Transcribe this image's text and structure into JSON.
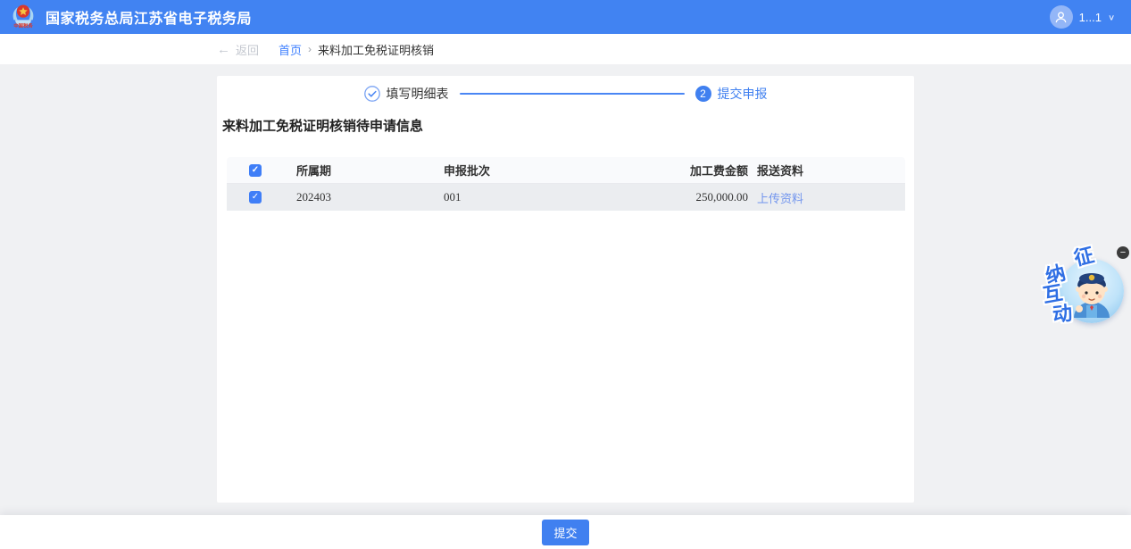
{
  "header": {
    "title": "国家税务总局江苏省电子税务局",
    "user_name": "1...1"
  },
  "breadcrumb": {
    "back_label": "返回",
    "home": "首页",
    "current": "来料加工免税证明核销"
  },
  "steps": {
    "step1_label": "填写明细表",
    "step2_number": "2",
    "step2_label": "提交申报"
  },
  "section_title": "来料加工免税证明核销待申请信息",
  "table": {
    "headers": {
      "period": "所属期",
      "batch": "申报批次",
      "amount": "加工费金额",
      "material": "报送资料"
    },
    "rows": [
      {
        "checked": true,
        "period": "202403",
        "batch": "001",
        "amount": "250,000.00",
        "upload_label": "上传资料"
      }
    ]
  },
  "footer": {
    "submit_label": "提交"
  },
  "assistant": {
    "chars": {
      "c1": "征",
      "c2": "纳",
      "c3": "互",
      "c4": "动"
    }
  },
  "icons": {
    "back_arrow": "←",
    "breadcrumb_sep": "›",
    "chevron_down": "∨",
    "check": "✓",
    "minus": "−"
  },
  "colors": {
    "header_blue": "#4183f2",
    "accent_blue": "#4080f0",
    "link_blue": "#3d7fff",
    "upload_link_blue": "#7295ee",
    "row_gray": "#ebedf0",
    "page_bg": "#f0f1f3"
  }
}
